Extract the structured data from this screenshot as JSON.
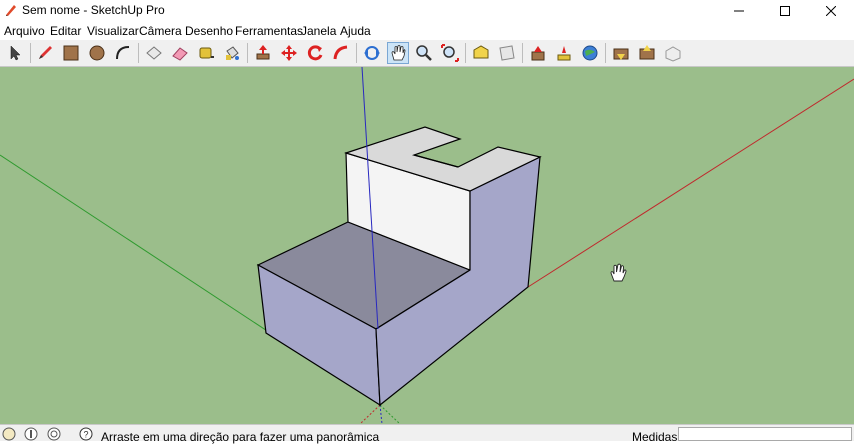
{
  "window": {
    "title": "Sem nome - SketchUp Pro",
    "controls": [
      "minimize-icon",
      "maximize-icon",
      "close-icon"
    ]
  },
  "menu": [
    "Arquivo",
    "Editar",
    "Visualizar",
    "Câmera",
    "Desenho",
    "Ferramentas",
    "Janela",
    "Ajuda"
  ],
  "toolbar": {
    "tools": [
      "select-icon",
      "pencil-icon",
      "rectangle-icon",
      "circle-icon",
      "arc-icon",
      "make-component-icon",
      "eraser-icon",
      "tape-measure-icon",
      "paint-bucket-icon",
      "push-pull-icon",
      "move-icon",
      "rotate-icon",
      "follow-me-icon",
      "orbit-icon",
      "pan-icon",
      "zoom-icon",
      "zoom-extents-icon",
      "warehouse-icon",
      "share-model-icon",
      "extension-warehouse-icon",
      "layout-icon",
      "geo-location-icon",
      "get-models-icon",
      "share-component-icon",
      "extension-manager-icon"
    ],
    "active_tool": "pan-icon"
  },
  "viewport": {
    "background": "#9bbe8b",
    "axes": {
      "red": "#c0282c",
      "green": "#2e9a2e",
      "blue": "#2828c0"
    },
    "cursor": "hand-pan-icon"
  },
  "status": {
    "message": "Arraste em uma direção para fazer uma panorâmica",
    "measure_label": "Medidas",
    "measure_value": ""
  }
}
